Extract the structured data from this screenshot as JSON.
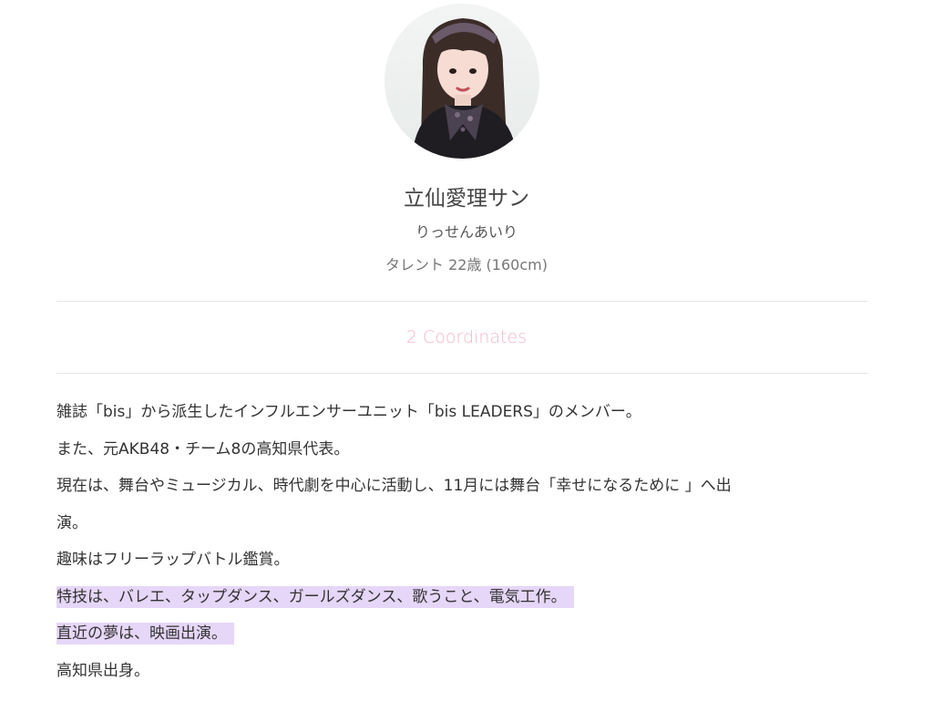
{
  "profile": {
    "avatar_alt": "立仙愛理 portrait",
    "name": "立仙愛理サン",
    "kana": "りっせんあいり",
    "meta": "タレント 22歳 (160cm)"
  },
  "coordinates_link": {
    "label": "2 Coordinates"
  },
  "bio": {
    "lines": [
      "雑誌「bis」から派生したインフルエンサーユニット「bis LEADERS」のメンバー。",
      "また、元AKB48・チーム8の高知県代表。",
      "現在は、舞台やミュージカル、時代劇を中心に活動し、11月には舞台「幸せになるために 」へ出",
      "演。",
      "趣味はフリーラップバトル鑑賞。",
      "特技は、バレエ、タップダンス、ガールズダンス、歌うこと、電気工作。",
      "直近の夢は、映画出演。",
      "高知県出身。"
    ]
  },
  "colors": {
    "link_pink": "#f0b7c6",
    "highlight_lavender": "#e6d6f7",
    "text_dark": "#333333",
    "divider": "#e4e4e4"
  }
}
